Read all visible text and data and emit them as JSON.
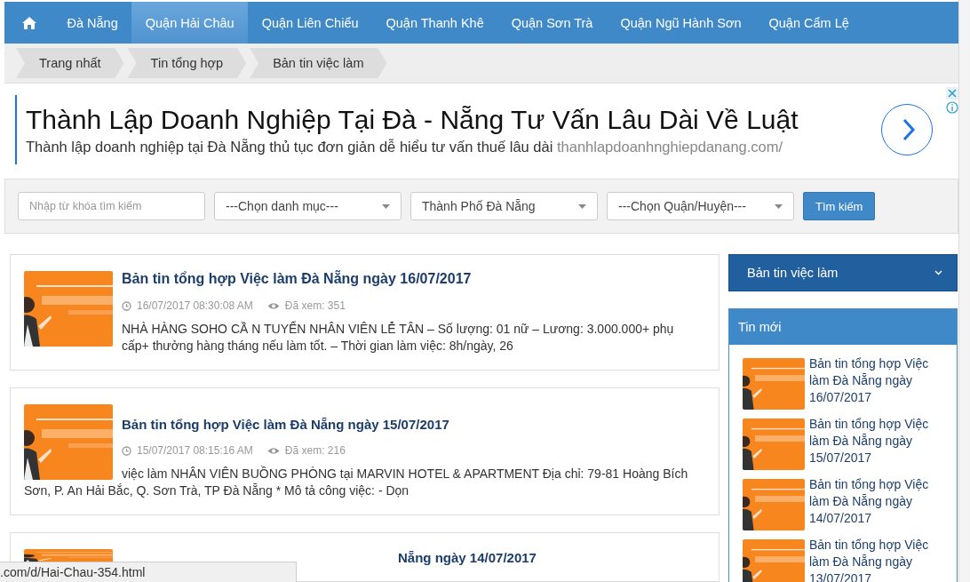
{
  "nav": {
    "items": [
      {
        "label": "Đà Nẵng",
        "selected": false
      },
      {
        "label": "Quận Hải Châu",
        "selected": true
      },
      {
        "label": "Quận Liên Chiểu",
        "selected": false
      },
      {
        "label": "Quận Thanh Khê",
        "selected": false
      },
      {
        "label": "Quận Sơn Trà",
        "selected": false
      },
      {
        "label": "Quận Ngũ Hành Sơn",
        "selected": false
      },
      {
        "label": "Quận Cẩm Lệ",
        "selected": false
      }
    ]
  },
  "breadcrumb": [
    "Trang nhất",
    "Tin tổng hợp",
    "Bản tin việc làm"
  ],
  "ad": {
    "title": "Thành Lập Doanh Nghiệp Tại Đà - Nẵng Tư Vấn Lâu Dài Về Luật",
    "description": "Thành lập doanh nghiệp tại Đà Nẵng thủ tục đơn giản dễ hiểu tư vấn thuế lâu dài",
    "url": "thanhlapdoanhnghiepdanang.com/"
  },
  "search": {
    "placeholder": "Nhập từ khóa tìm kiếm",
    "selects": [
      "---Chọn danh mục---",
      "Thành Phố Đà Nẵng",
      "---Chọn Quận/Huyện---"
    ],
    "button": "Tìm kiếm"
  },
  "posts": [
    {
      "title": "Bản tin tổng hợp Việc làm Đà Nẵng ngày 16/07/2017",
      "datetime": "16/07/2017 08:30:08 AM",
      "views": "Đã xem: 351",
      "excerpt": "NHÀ HÀNG SOHO CẦ N TUYỂN NHÂN VIÊN LỄ TÂN – Số lượng: 01 nữ – Lương: 3.000.000+ phụ cấp+ thưởng hàng tháng nếu làm tốt. – Thời gian làm việc: 8h/ngày, 26"
    },
    {
      "title": "Bản tin tổng hợp Việc làm Đà Nẵng ngày 15/07/2017",
      "datetime": "15/07/2017 08:15:16 AM",
      "views": "Đã xem: 216",
      "excerpt": "việc làm NHÂN VIÊN BUỒNG PHÒNG tại MARVIN HOTEL & APARTMENT Địa chỉ: 79-81 Hoàng Bích Sơn, P. An Hải Bắc, Q. Sơn Trà, TP Đà Nẵng * Mô tả công việc: - Dọn"
    },
    {
      "title": "Nẵng ngày 14/07/2017"
    }
  ],
  "sidebar": {
    "dropdown": "Bản tin việc làm",
    "latest": {
      "heading": "Tin mới",
      "items": [
        "Bản tin tổng hợp Việc làm Đà Nẵng ngày 16/07/2017",
        "Bản tin tổng hợp Việc làm Đà Nẵng ngày 15/07/2017",
        "Bản tin tổng hợp Việc làm Đà Nẵng ngày 14/07/2017",
        "Bản tin tổng hợp Việc làm Đà Nẵng ngày 13/07/2017"
      ]
    }
  },
  "status_bar": ".com/d/Hai-Chau-354.html"
}
